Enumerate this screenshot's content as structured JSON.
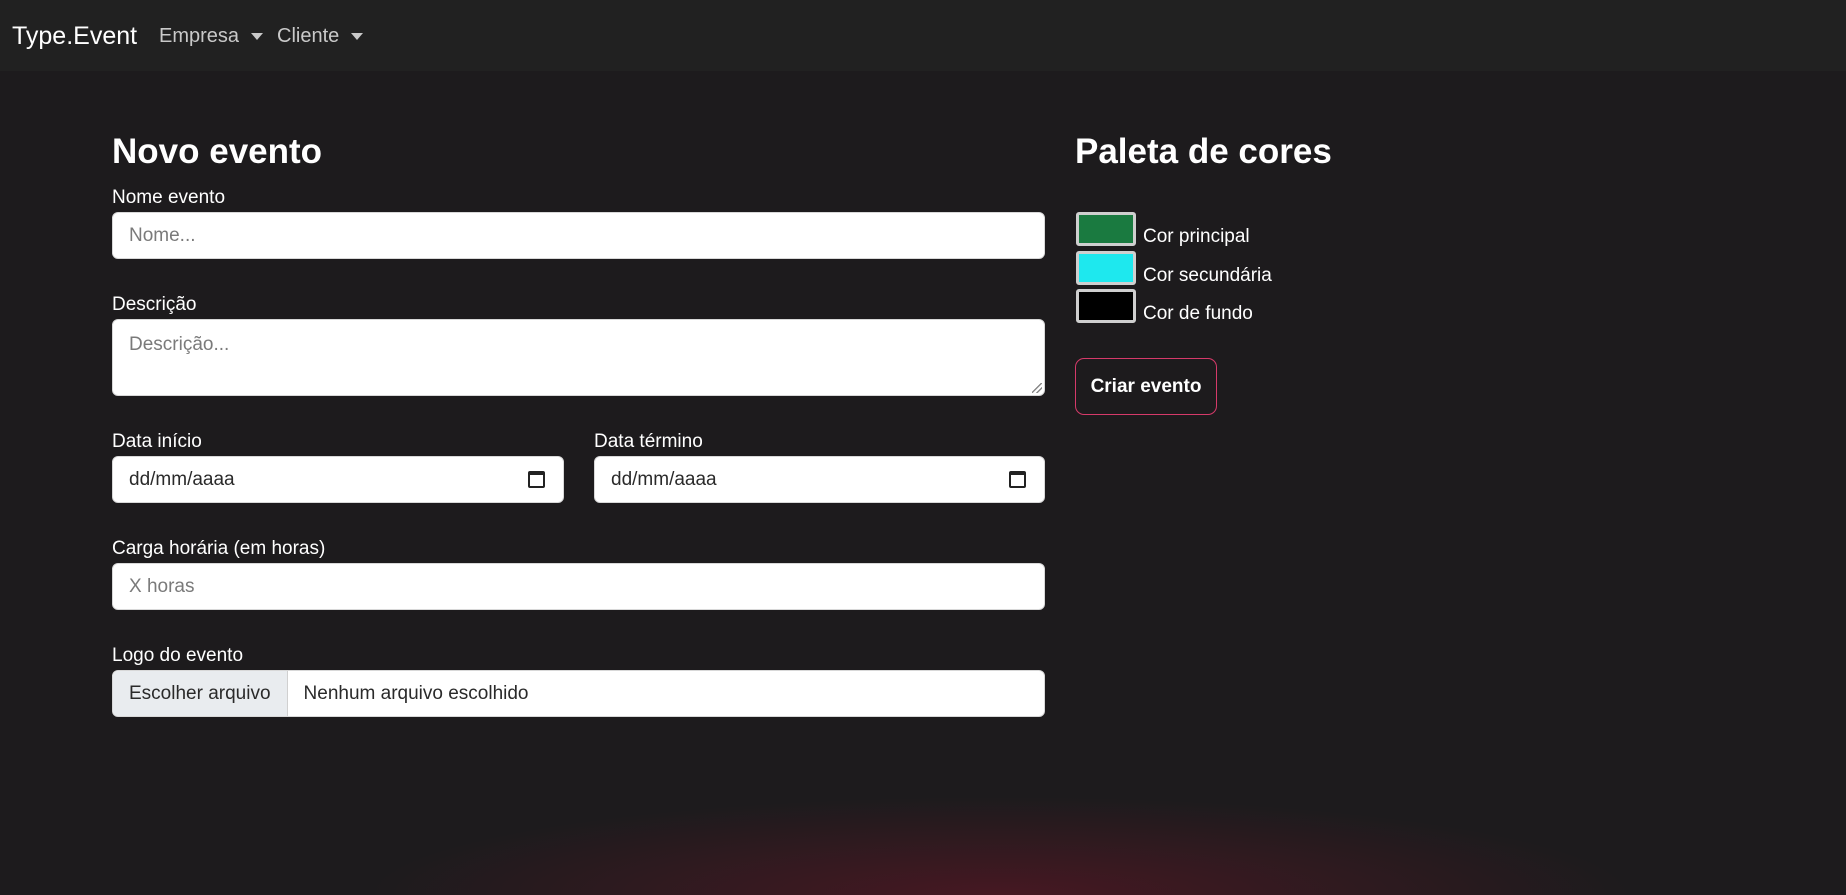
{
  "navbar": {
    "brand": "Type.Event",
    "menus": [
      {
        "label": "Empresa"
      },
      {
        "label": "Cliente"
      }
    ]
  },
  "form": {
    "title": "Novo evento",
    "nome": {
      "label": "Nome evento",
      "placeholder": "Nome..."
    },
    "descricao": {
      "label": "Descrição",
      "placeholder": "Descrição..."
    },
    "data_inicio": {
      "label": "Data início",
      "value": "dd/mm/aaaa",
      "icon": "calendar-icon"
    },
    "data_termino": {
      "label": "Data término",
      "value": "dd/mm/aaaa",
      "icon": "calendar-icon"
    },
    "carga": {
      "label": "Carga horária (em horas)",
      "placeholder": "X horas"
    },
    "logo": {
      "label": "Logo do evento",
      "button": "Escolher arquivo",
      "status": "Nenhum arquivo escolhido"
    }
  },
  "palette": {
    "title": "Paleta de cores",
    "colors": [
      {
        "label": "Cor principal",
        "value": "#1a7a40"
      },
      {
        "label": "Cor secundária",
        "value": "#1ee8ee"
      },
      {
        "label": "Cor de fundo",
        "value": "#000000"
      }
    ],
    "submit": "Criar evento",
    "accent": "#d63a6a"
  }
}
